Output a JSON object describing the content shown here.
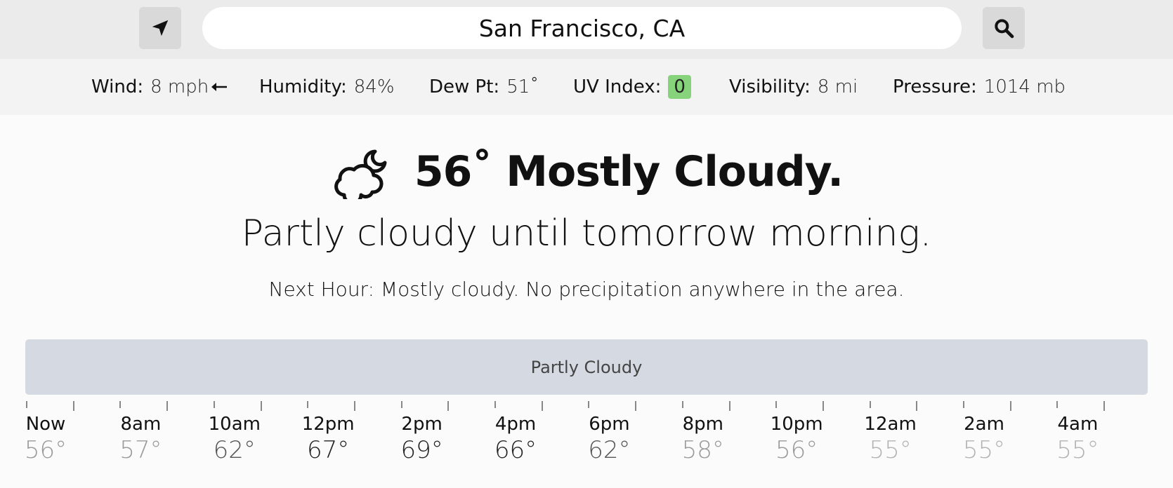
{
  "search": {
    "value": "San Francisco, CA",
    "location_icon": "navigation-arrow-icon",
    "search_icon": "magnifier-icon"
  },
  "conditions": {
    "wind": {
      "label": "Wind:",
      "value": "8 mph",
      "direction_icon": "arrow-left-icon"
    },
    "humidity": {
      "label": "Humidity:",
      "value": "84%"
    },
    "dew_point": {
      "label": "Dew Pt:",
      "value": "51˚"
    },
    "uv_index": {
      "label": "UV Index:",
      "value": "0",
      "badge_color": "#87d37c"
    },
    "visibility": {
      "label": "Visibility:",
      "value": "8 mi"
    },
    "pressure": {
      "label": "Pressure:",
      "value": "1014 mb"
    }
  },
  "summary": {
    "icon": "partly-cloudy-night-icon",
    "title": "56˚ Mostly Cloudy.",
    "subtitle": "Partly cloudy until tomorrow morning.",
    "next_hour": "Next Hour: Mostly cloudy. No precipitation anywhere in the area."
  },
  "timeline": {
    "bar_label": "Partly Cloudy",
    "bar_color": "#d5dae2",
    "hours": [
      {
        "label": "Now",
        "temp": "56°",
        "emphasis": "muted"
      },
      {
        "label": "8am",
        "temp": "57°",
        "emphasis": "muted"
      },
      {
        "label": "10am",
        "temp": "62°",
        "emphasis": "mid"
      },
      {
        "label": "12pm",
        "temp": "67°",
        "emphasis": "strong"
      },
      {
        "label": "2pm",
        "temp": "69°",
        "emphasis": "strong"
      },
      {
        "label": "4pm",
        "temp": "66°",
        "emphasis": "strong"
      },
      {
        "label": "6pm",
        "temp": "62°",
        "emphasis": "mid"
      },
      {
        "label": "8pm",
        "temp": "58°",
        "emphasis": "muted"
      },
      {
        "label": "10pm",
        "temp": "56°",
        "emphasis": "muted"
      },
      {
        "label": "12am",
        "temp": "55°",
        "emphasis": "light"
      },
      {
        "label": "2am",
        "temp": "55°",
        "emphasis": "light"
      },
      {
        "label": "4am",
        "temp": "55°",
        "emphasis": "light"
      }
    ],
    "temp_colors": {
      "strong": "#222222",
      "mid": "#555555",
      "muted": "#999999",
      "light": "#b3b3b3"
    }
  }
}
